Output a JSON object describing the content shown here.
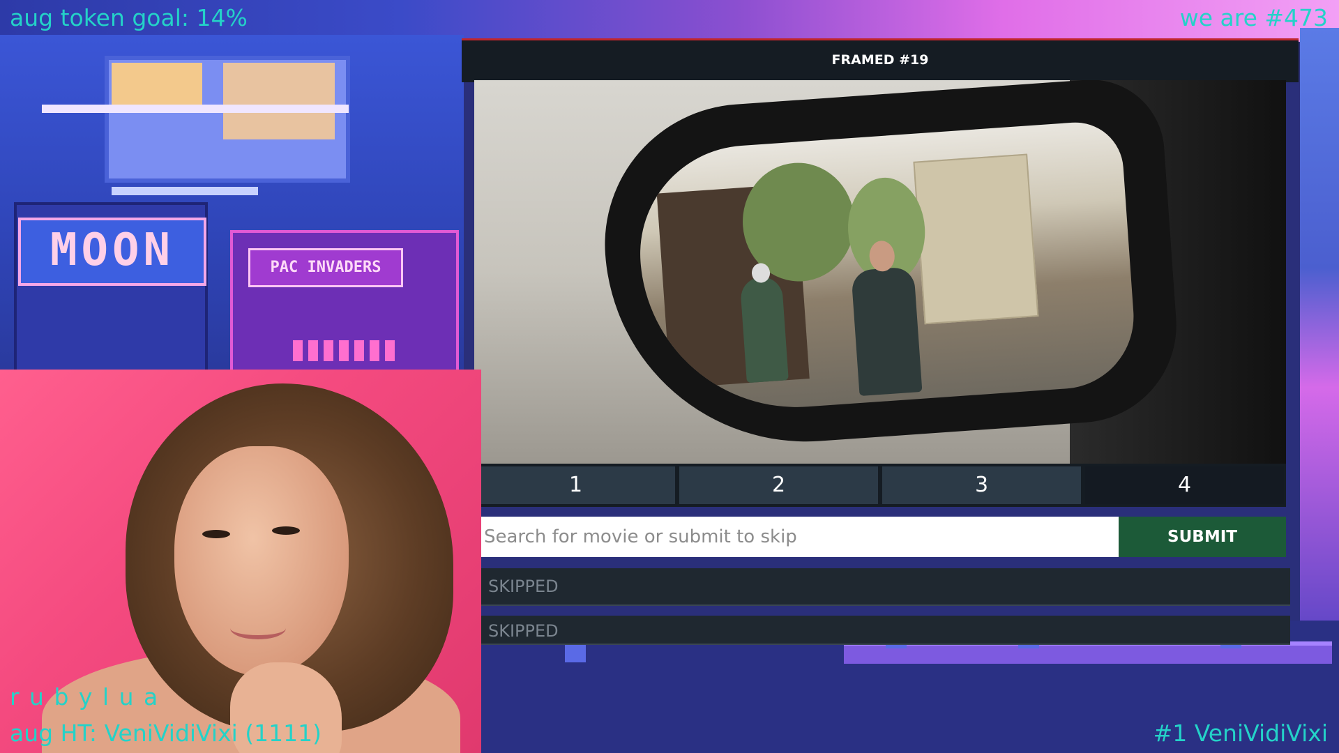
{
  "overlay": {
    "token_goal": "aug token goal: 14%",
    "rank": "we are #473",
    "username": "r u b y l u a",
    "aug_ht": "aug HT: VeniVidiVixi (1111)",
    "top_tipper": "#1  VeniVidiVixi"
  },
  "background": {
    "moon_sign": "MOON",
    "invaders_sign": "PAC INVADERS"
  },
  "game": {
    "title": "FRAMED #19",
    "tabs": [
      {
        "label": "1",
        "active": false
      },
      {
        "label": "2",
        "active": false
      },
      {
        "label": "3",
        "active": false
      },
      {
        "label": "4",
        "active": true
      }
    ],
    "search": {
      "value": "",
      "placeholder": "Search for movie or submit to skip"
    },
    "submit_label": "SUBMIT",
    "guesses": [
      {
        "label": "SKIPPED"
      },
      {
        "label": "SKIPPED"
      }
    ]
  },
  "colors": {
    "overlay_text": "#24d2c8",
    "submit_green": "#1c5a38",
    "header_red": "#c0262d",
    "panel_dark": "#151c23"
  }
}
